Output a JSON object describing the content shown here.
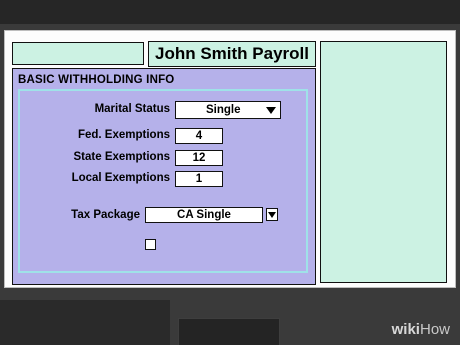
{
  "window": {
    "title": "John Smith Payroll"
  },
  "section": {
    "title": "BASIC WITHHOLDING INFO"
  },
  "fields": {
    "marital_status": {
      "label": "Marital Status",
      "value": "Single"
    },
    "fed_exemptions": {
      "label": "Fed. Exemptions",
      "value": "4"
    },
    "state_exemptions": {
      "label": "State Exemptions",
      "value": "12"
    },
    "local_exemptions": {
      "label": "Local Exemptions",
      "value": "1"
    },
    "tax_package": {
      "label": "Tax Package",
      "value": "CA Single"
    }
  },
  "checkbox": {
    "checked": false
  },
  "watermark": {
    "part1": "wiki",
    "part2": "How"
  },
  "colors": {
    "panel": "#b5b1ea",
    "mint": "#ccf2e3",
    "frame": "#9fe2e8"
  },
  "icons": [
    "chevron-down-icon",
    "checkbox-icon"
  ]
}
